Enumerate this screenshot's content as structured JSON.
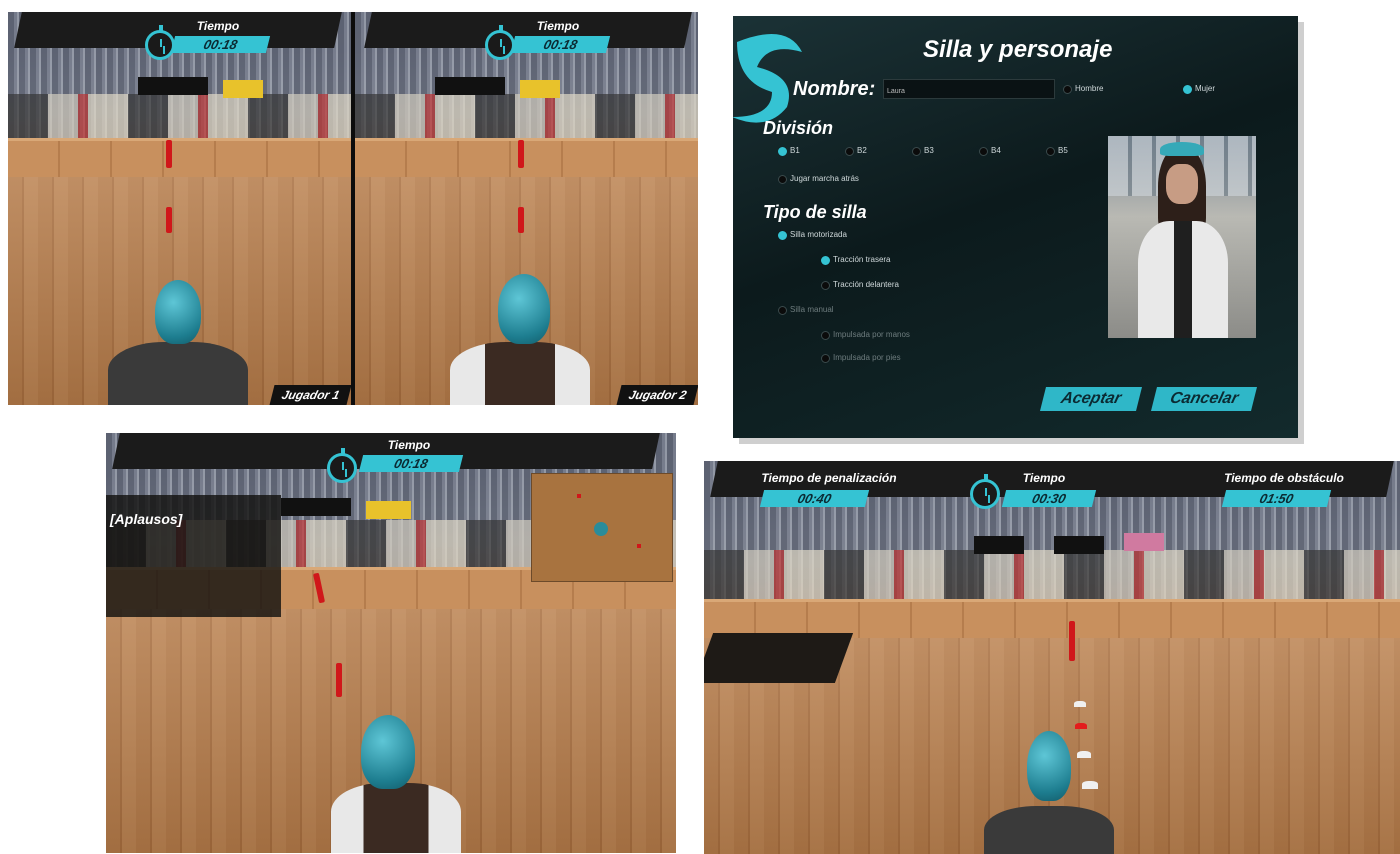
{
  "split_screen": {
    "left": {
      "timer_label": "Tiempo",
      "timer_value": "00:18",
      "player_tag": "Jugador 1"
    },
    "right": {
      "timer_label": "Tiempo",
      "timer_value": "00:18",
      "player_tag": "Jugador 2"
    }
  },
  "settings_dialog": {
    "title": "Silla y personaje",
    "name_label": "Nombre:",
    "name_value": "Laura",
    "gender_options": [
      "Hombre",
      "Mujer"
    ],
    "gender_selected": "Mujer",
    "division_heading": "División",
    "divisions": [
      "B1",
      "B2",
      "B3",
      "B4",
      "B5"
    ],
    "division_selected": "B1",
    "march_option": "Jugar marcha atrás",
    "chair_heading": "Tipo de silla",
    "chair_options": [
      {
        "label": "Silla motorizada",
        "selected": true,
        "level": 0
      },
      {
        "label": "Tracción trasera",
        "selected": true,
        "level": 1
      },
      {
        "label": "Tracción delantera",
        "selected": false,
        "level": 1
      },
      {
        "label": "Silla manual",
        "selected": false,
        "level": 0
      },
      {
        "label": "Impulsada por manos",
        "selected": false,
        "level": 1
      },
      {
        "label": "Impulsada por pies",
        "selected": false,
        "level": 1
      }
    ],
    "accept_button": "Aceptar",
    "cancel_button": "Cancelar"
  },
  "single_view": {
    "timer_label": "Tiempo",
    "timer_value": "00:18",
    "caption": "[Aplausos]"
  },
  "challenge_view": {
    "penalty_label": "Tiempo de penalización",
    "penalty_value": "00:40",
    "timer_label": "Tiempo",
    "timer_value": "00:30",
    "obstacle_label": "Tiempo de obstáculo",
    "obstacle_value": "01:50"
  },
  "colors": {
    "accent": "#35c3d3",
    "hud_dark": "#1b1b1b",
    "floor": "#b57a48",
    "cone": "#d0171a"
  }
}
